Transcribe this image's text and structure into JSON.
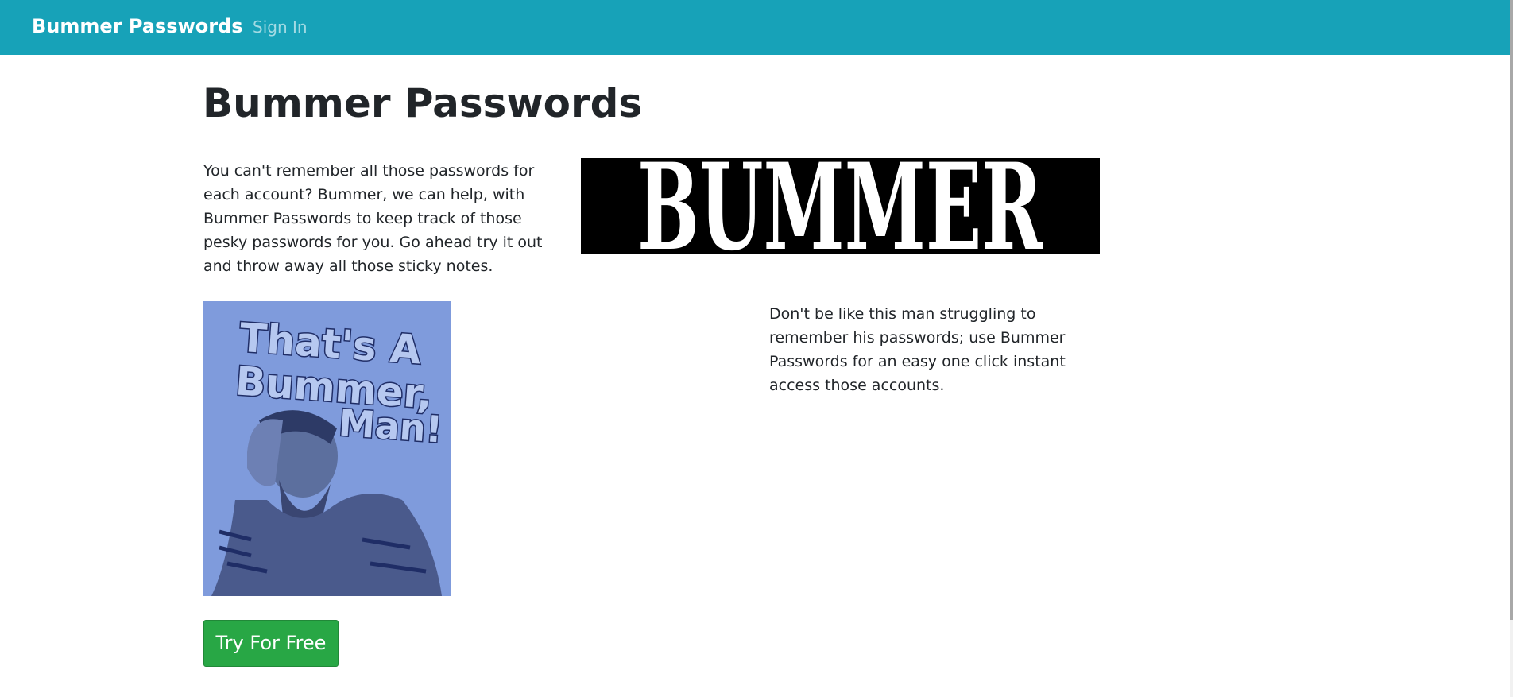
{
  "navbar": {
    "brand": "Bummer Passwords",
    "sign_in": "Sign In",
    "background_color": "#17a2b8"
  },
  "main": {
    "title": "Bummer Passwords",
    "intro": "You can't remember all those passwords for each account? Bummer, we can help, with Bummer Passwords to keep track of those pesky passwords for you. Go ahead try it out and throw away all those sticky notes.",
    "banner_logo_text": "BUMMER",
    "tshirt_lines": [
      "That's A",
      "Bummer,",
      "Man!"
    ],
    "side_text": "Don't be like this man struggling to remember his passwords; use Bummer Passwords for an easy one click instant access those accounts.",
    "cta_label": "Try For Free",
    "cta_color": "#28a745"
  }
}
